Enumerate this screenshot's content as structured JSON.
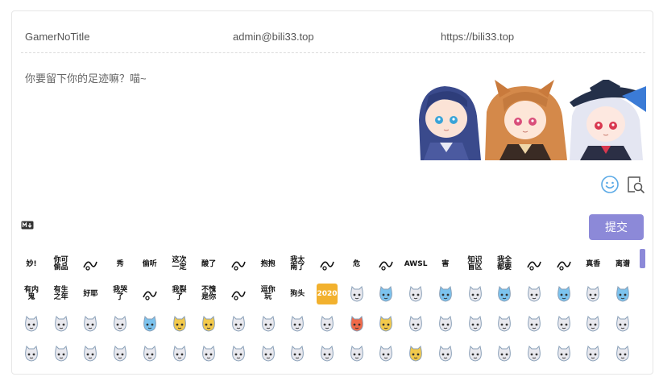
{
  "form": {
    "nick_placeholder": "GamerNoTitle",
    "mail_placeholder": "admin@bili33.top",
    "link_placeholder": "https://bili33.top",
    "editor_placeholder": "你要留下你的足迹嘛？喵~",
    "submit_label": "提交",
    "markdown_badge": "M↓"
  },
  "icons": {
    "emoji_button": "smile-face-icon",
    "preview_button": "preview-search-icon"
  },
  "colors": {
    "accent": "#8c89d8",
    "border": "#e6e6e6",
    "text": "#555555"
  },
  "emoji_text_stickers_row1": [
    "妙!",
    "你可偷品",
    "",
    "秀",
    "偷听",
    "这次一定",
    "酸了",
    "",
    "抱抱",
    "我太南了",
    "",
    "危",
    "",
    "AWSL",
    "害",
    "知识盲区",
    "我全都要",
    "",
    "",
    "真香",
    "离谱"
  ],
  "emoji_text_stickers_row2": [
    "有内鬼",
    "有生之年",
    "好耶",
    "我哭了",
    "",
    "我裂了",
    "不愧是你",
    "",
    "逗你玩",
    "狗头",
    "2020"
  ]
}
